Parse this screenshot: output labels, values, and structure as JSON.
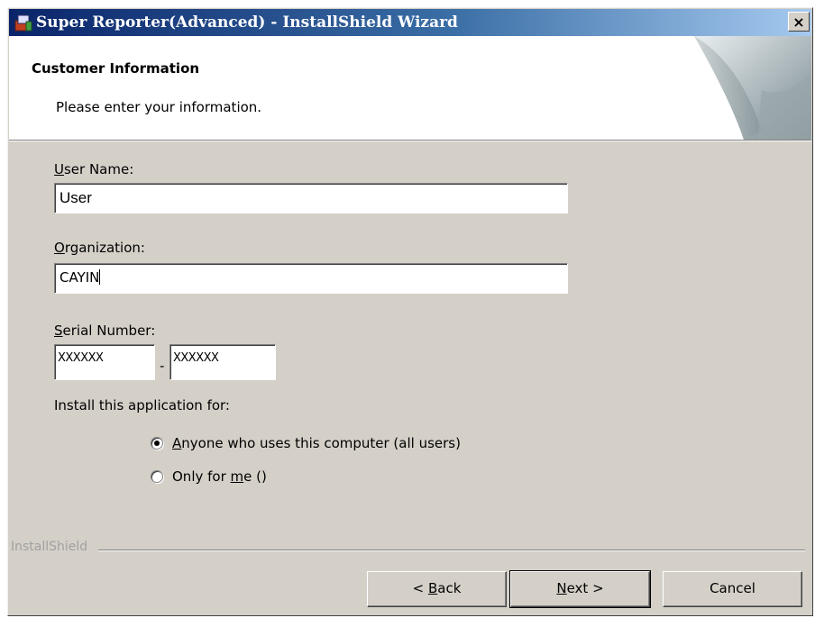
{
  "window": {
    "title": "Super Reporter(Advanced) - InstallShield Wizard",
    "close_glyph": "×"
  },
  "header": {
    "title": "Customer Information",
    "subtitle": "Please enter your information."
  },
  "form": {
    "user_name": {
      "label_key": "U",
      "label_rest": "ser Name:",
      "value": "User"
    },
    "organization": {
      "label_key": "O",
      "label_rest": "rganization:",
      "value": "CAYIN"
    },
    "serial": {
      "label_key": "S",
      "label_rest": "erial Number:",
      "part1": "XXXXXX",
      "separator": "-",
      "part2": "XXXXXX"
    },
    "install_for": {
      "label": "Install this application for:",
      "options": [
        {
          "key": "A",
          "rest": "nyone who uses this computer (all users)",
          "checked": true
        },
        {
          "pre": "Only for ",
          "key": "m",
          "rest": "e ()",
          "checked": false
        }
      ]
    }
  },
  "footer": {
    "brand": "InstallShield",
    "back": {
      "pre": "< ",
      "key": "B",
      "rest": "ack"
    },
    "next": {
      "key": "N",
      "rest": "ext >"
    },
    "cancel": "Cancel"
  },
  "icons": {
    "title_icon": "installer-app-icon",
    "close": "close-icon",
    "header_art": "page-curl-art"
  }
}
